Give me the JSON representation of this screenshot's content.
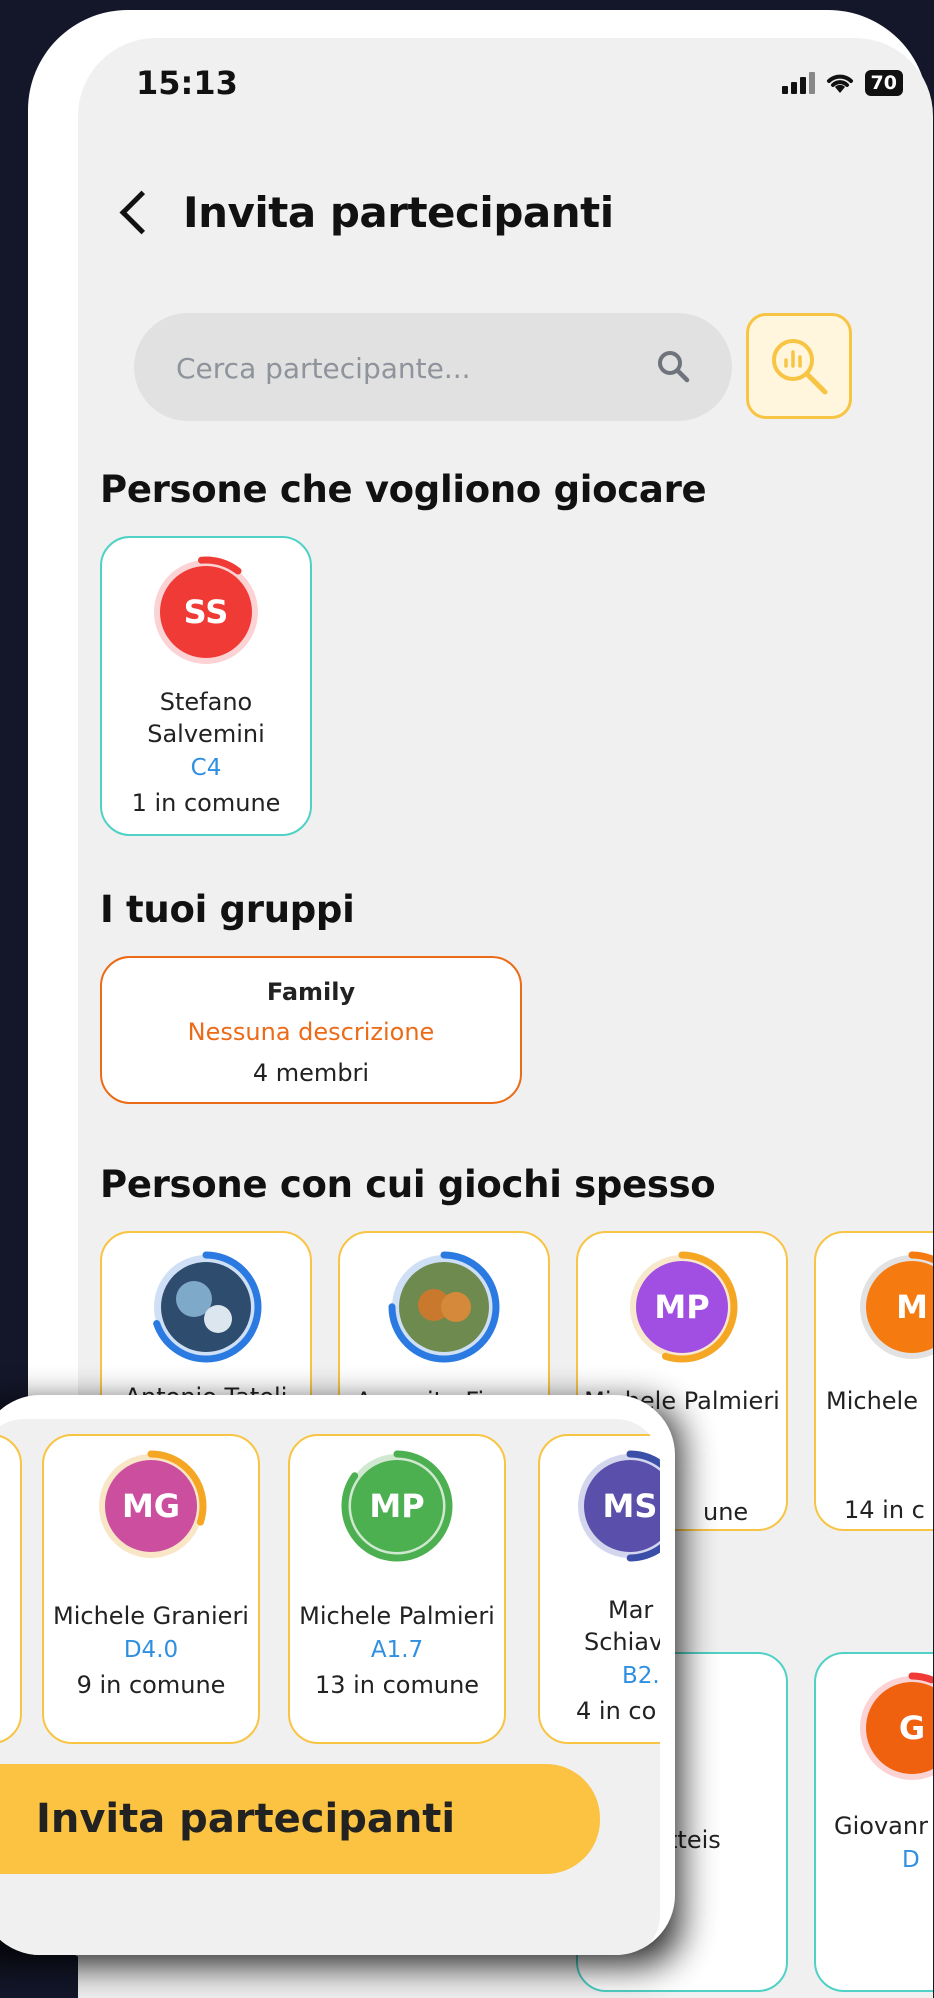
{
  "status_bar": {
    "time": "15:13",
    "battery": "70"
  },
  "header": {
    "title": "Invita partecipanti"
  },
  "search": {
    "placeholder": "Cerca partecipante..."
  },
  "sections": {
    "want_to_play": "Persone che vogliono giocare",
    "groups": "I tuoi gruppi",
    "play_often": "Persone con cui giochi spesso"
  },
  "want_to_play": [
    {
      "initials": "SS",
      "name_line1": "Stefano",
      "name_line2": "Salvemini",
      "level": "C4",
      "common": "1 in comune",
      "avatar_color": "#f03a35",
      "ring_color": "#f03a35",
      "ring_bg": "#fbd3d5",
      "ring_fraction": 0.12
    }
  ],
  "groups": [
    {
      "name": "Family",
      "description": "Nessuna descrizione",
      "members": "4 membri"
    }
  ],
  "play_often": [
    {
      "name": "Antonio Tatoli",
      "photo": true,
      "ring_color": "#2a7ae2",
      "ring_bg": "#cfe0f6",
      "ring_fraction": 0.7
    },
    {
      "name": "Annarita Fierro",
      "photo": true,
      "ring_color": "#2a7ae2",
      "ring_bg": "#cfe0f6",
      "ring_fraction": 0.75
    },
    {
      "name": "Michele Palmieri",
      "initials": "MP",
      "avatar_color": "#a14fe3",
      "ring_color": "#f5a623",
      "ring_bg": "#f8e8cc",
      "ring_fraction": 0.55,
      "common_tail": "une"
    },
    {
      "name": "Michele ",
      "initials": "M",
      "avatar_color": "#f57a10",
      "ring_color": "#f57a10",
      "ring_bg": "#e2e2e2",
      "ring_fraction": 0.3,
      "common": "14 in c"
    }
  ],
  "second_row": {
    "partial_name": "tteis",
    "giovanni_name": "Giovanr",
    "giovanni_initials": "G",
    "giovanni_level": "D"
  },
  "overlay": {
    "cards": [
      {
        "initials": "MG",
        "name": "Michele Granieri",
        "level": "D4.0",
        "common": "9 in comune",
        "avatar_color": "#cc4f9f",
        "ring_color": "#f5a623",
        "ring_bg": "#f8e6c6",
        "ring_fraction": 0.3
      },
      {
        "initials": "MP",
        "name": "Michele Palmieri",
        "level": "A1.7",
        "common": "13 in comune",
        "avatar_color": "#4caf50",
        "ring_color": "#4caf50",
        "ring_bg": "#cfe8cf",
        "ring_fraction": 0.85
      },
      {
        "initials": "MS",
        "name_line1": "Mar",
        "name_line2": "Schiav",
        "level": "B2.",
        "common": "4 in co",
        "avatar_color": "#5a4faa",
        "ring_color": "#3b4fa8",
        "ring_bg": "#d4d6ee",
        "ring_fraction": 0.5
      }
    ],
    "invite_button": "Invita partecipanti"
  }
}
